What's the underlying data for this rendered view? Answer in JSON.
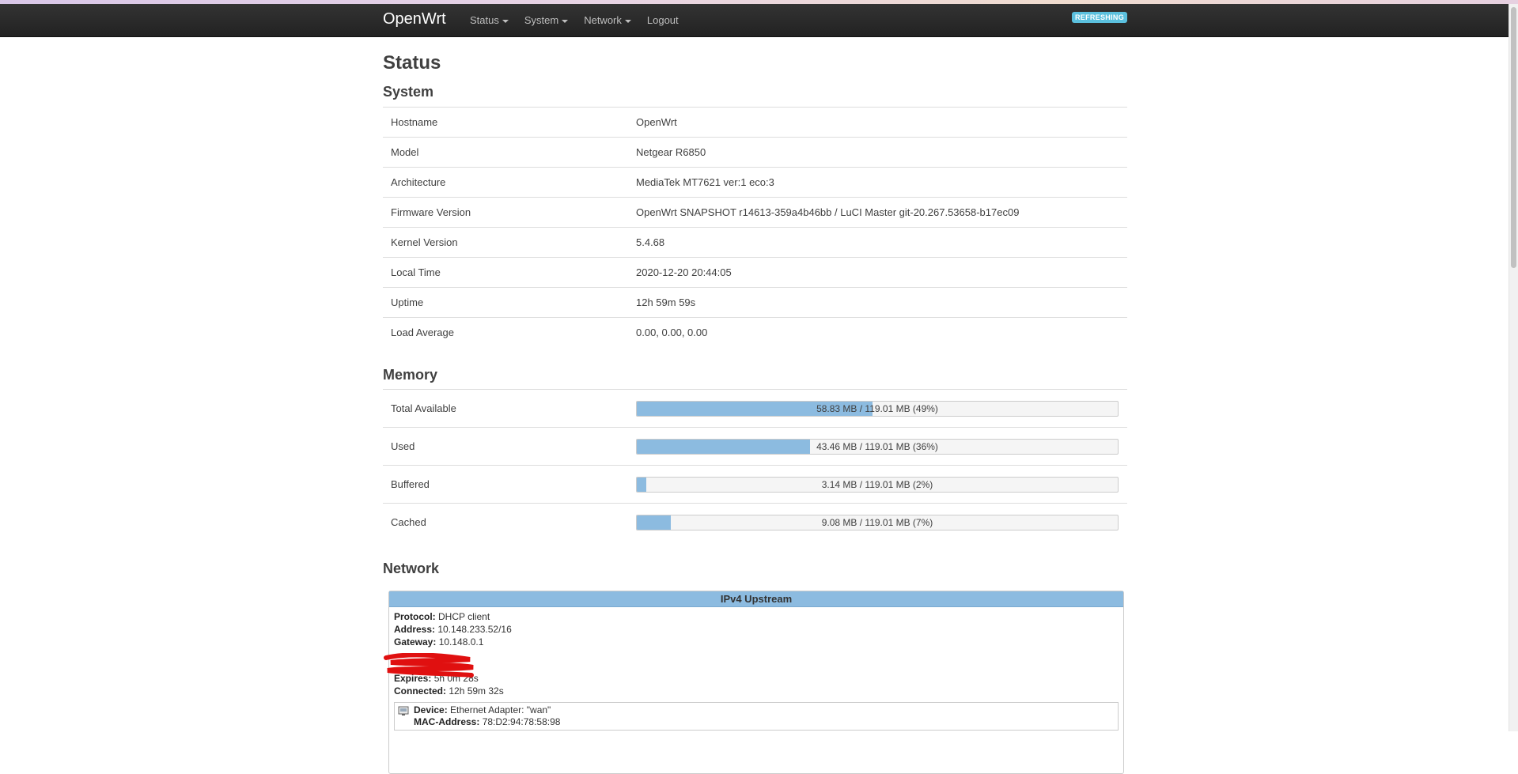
{
  "nav": {
    "brand": "OpenWrt",
    "menu": [
      {
        "label": "Status",
        "dropdown": true
      },
      {
        "label": "System",
        "dropdown": true
      },
      {
        "label": "Network",
        "dropdown": true
      },
      {
        "label": "Logout",
        "dropdown": false
      }
    ],
    "badge": "REFRESHING"
  },
  "page_title": "Status",
  "system": {
    "title": "System",
    "rows": [
      {
        "label": "Hostname",
        "value": "OpenWrt"
      },
      {
        "label": "Model",
        "value": "Netgear R6850"
      },
      {
        "label": "Architecture",
        "value": "MediaTek MT7621 ver:1 eco:3"
      },
      {
        "label": "Firmware Version",
        "value": "OpenWrt SNAPSHOT r14613-359a4b46bb / LuCI Master git-20.267.53658-b17ec09"
      },
      {
        "label": "Kernel Version",
        "value": "5.4.68"
      },
      {
        "label": "Local Time",
        "value": "2020-12-20 20:44:05"
      },
      {
        "label": "Uptime",
        "value": "12h 59m 59s"
      },
      {
        "label": "Load Average",
        "value": "0.00, 0.00, 0.00"
      }
    ]
  },
  "memory": {
    "title": "Memory",
    "rows": [
      {
        "label": "Total Available",
        "text": "58.83 MB / 119.01 MB (49%)",
        "percent": 49
      },
      {
        "label": "Used",
        "text": "43.46 MB / 119.01 MB (36%)",
        "percent": 36
      },
      {
        "label": "Buffered",
        "text": "3.14 MB / 119.01 MB (2%)",
        "percent": 2
      },
      {
        "label": "Cached",
        "text": "9.08 MB / 119.01 MB (7%)",
        "percent": 7
      }
    ]
  },
  "network": {
    "title": "Network",
    "box_title": "IPv4 Upstream",
    "protocol_label": "Protocol:",
    "protocol": "DHCP client",
    "address_label": "Address:",
    "address": "10.148.233.52/16",
    "gateway_label": "Gateway:",
    "gateway": "10.148.0.1",
    "expires_label": "Expires:",
    "expires": "5h 0m 28s",
    "connected_label": "Connected:",
    "connected": "12h 59m 32s",
    "device_label": "Device:",
    "device": "Ethernet Adapter: \"wan\"",
    "mac_label": "MAC-Address:",
    "mac": "78:D2:94:78:58:98"
  },
  "colors": {
    "progress_fill": "#8cbbe0",
    "badge": "#5bc0de",
    "navbar": "#222222"
  }
}
